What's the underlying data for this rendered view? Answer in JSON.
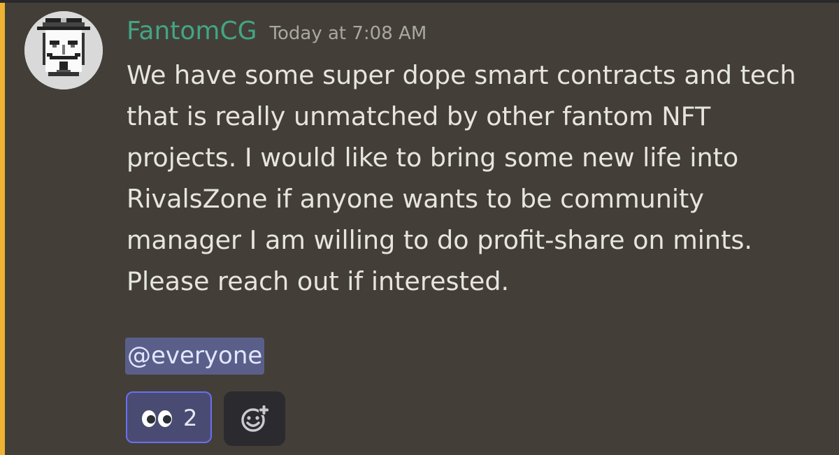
{
  "message": {
    "author": "FantomCG",
    "timestamp": "Today at 7:08 AM",
    "content": "We have some super dope smart contracts and tech\nthat is really unmatched by other fantom NFT\nprojects. I would like to bring some new life into\nRivalsZone if anyone wants to be community\nmanager I am willing to do profit-share on mints.\nPlease reach out if interested.",
    "mention": "@everyone"
  },
  "reactions": [
    {
      "emoji": "eyes-icon",
      "count": "2"
    }
  ],
  "colors": {
    "background": "#433f38",
    "mention_highlight_bar": "#f0b232",
    "username": "#43a585",
    "mention_bg": "#5a5f8a",
    "reaction_border": "#6a6ff2"
  }
}
